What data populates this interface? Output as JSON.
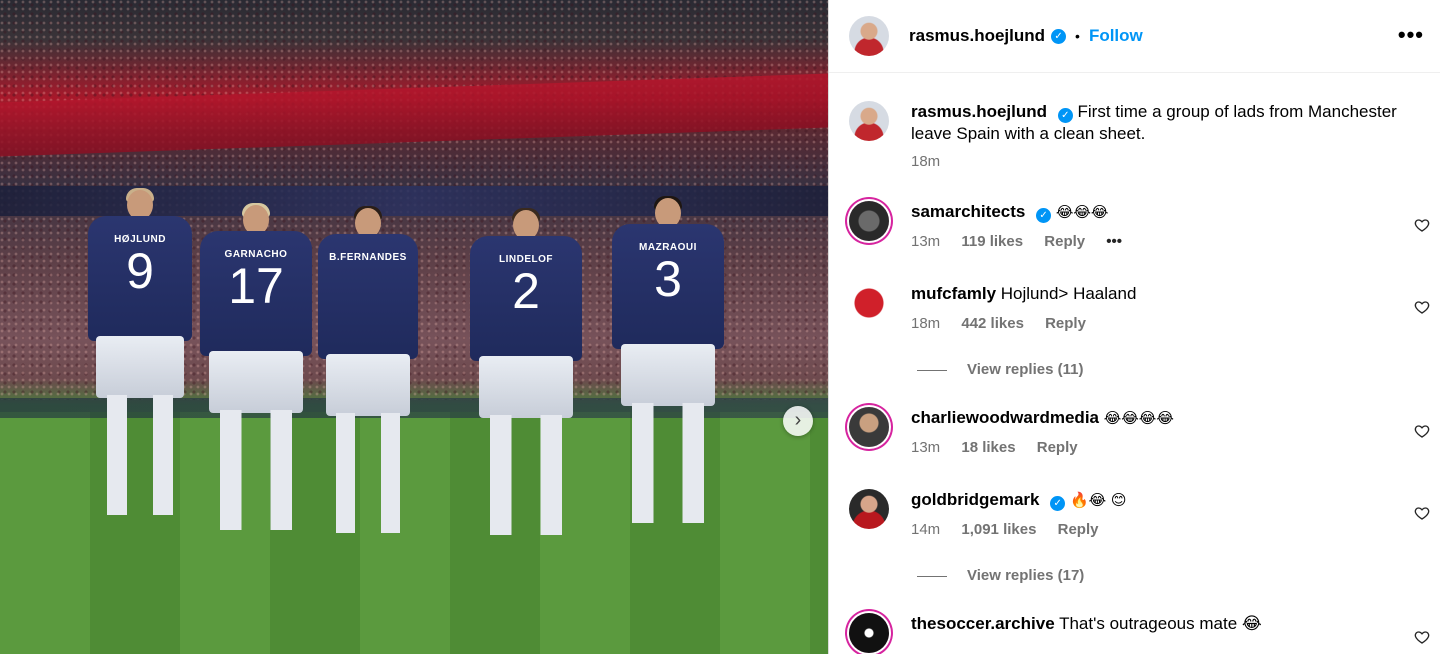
{
  "post": {
    "username": "rasmus.hoejlund",
    "follow_label": "Follow",
    "more_icon": "more-icon",
    "caption": "First time a group of lads from Manchester leave Spain with a clean sheet.",
    "caption_time": "18m"
  },
  "photo": {
    "players": [
      {
        "name": "HØJLUND",
        "number": "9"
      },
      {
        "name": "GARNACHO",
        "number": "17"
      },
      {
        "name": "B.FERNANDES",
        "number": ""
      },
      {
        "name": "LINDELOF",
        "number": "2"
      },
      {
        "name": "MAZRAOUI",
        "number": "3"
      }
    ],
    "next_icon": "chevron-right-icon"
  },
  "comments": [
    {
      "user": "samarchitects",
      "verified": true,
      "text": "😂😂😂",
      "time": "13m",
      "likes": "119 likes",
      "reply": "Reply",
      "options": "•••"
    },
    {
      "user": "mufcfamly",
      "verified": false,
      "text": "Hojlund> Haaland",
      "time": "18m",
      "likes": "442 likes",
      "reply": "Reply",
      "view_replies": "View replies (11)"
    },
    {
      "user": "charliewoodwardmedia",
      "verified": false,
      "text": "😂😂😂😂",
      "time": "13m",
      "likes": "18 likes",
      "reply": "Reply"
    },
    {
      "user": "goldbridgemark",
      "verified": true,
      "text": "🔥😂 😊",
      "time": "14m",
      "likes": "1,091 likes",
      "reply": "Reply",
      "view_replies": "View replies (17)"
    },
    {
      "user": "thesoccer.archive",
      "verified": false,
      "text": "That's outrageous mate 😂"
    }
  ],
  "colors": {
    "accent": "#0095f6",
    "meta": "#737373"
  }
}
